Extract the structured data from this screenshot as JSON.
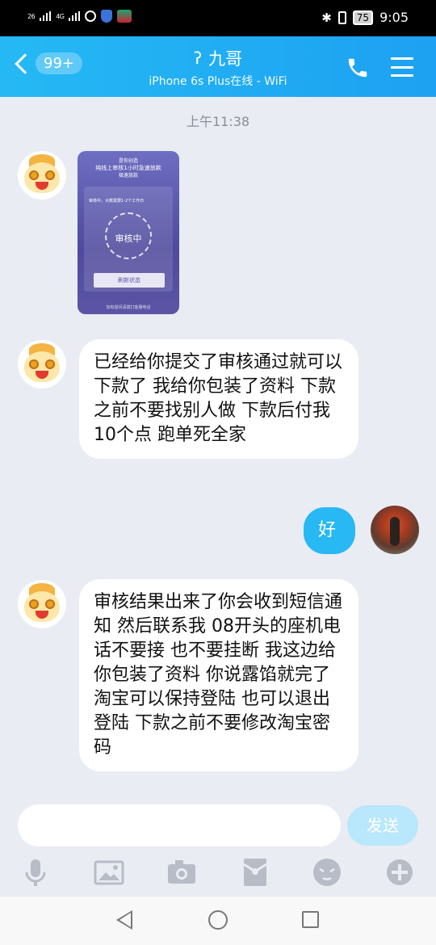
{
  "status_bar": {
    "signal_1": "26",
    "signal_2": "4G",
    "battery": "75",
    "time": "9:05"
  },
  "header": {
    "back_badge": "99+",
    "contact_name": "九哥",
    "contact_status": "iPhone 6s Plus在线 - WiFi",
    "icons": [
      "ear-icon",
      "phone-icon",
      "menu-icon"
    ]
  },
  "chat": {
    "timestamp": "上午11:38",
    "image_message": {
      "header_line_1": "是你创造",
      "header_line_2": "纯线上审核1小时急速放款",
      "header_line_3": "极速放款",
      "progress_note": "审核中，大概需要1-2个工作日",
      "status": "审核中",
      "button": "刷新状态",
      "footer": "如有疑问请拨打客服电话"
    },
    "messages": [
      {
        "sender": "contact",
        "text": "已经给你提交了审核通过就可以下款了 我给你包装了资料 下款之前不要找别人做  下款后付我10个点 跑单死全家"
      },
      {
        "sender": "me",
        "text": "好"
      },
      {
        "sender": "contact",
        "text": "审核结果出来了你会收到短信通知 然后联系我 08开头的座机电话不要接 也不要挂断 我这边给你包装了资料 你说露馅就完了  淘宝可以保持登陆 也可以退出登陆  下款之前不要修改淘宝密码"
      }
    ]
  },
  "input_bar": {
    "send_label": "发送",
    "placeholder": ""
  },
  "toolbar": {
    "icons": [
      "microphone-icon",
      "image-icon",
      "camera-icon",
      "red-packet-icon",
      "emoji-icon",
      "plus-icon"
    ]
  },
  "colors": {
    "header_blue": "#1da1f2",
    "my_bubble": "#28b8f4",
    "chat_bg": "#e9ecf3",
    "send_disabled": "#b9e7fb"
  }
}
